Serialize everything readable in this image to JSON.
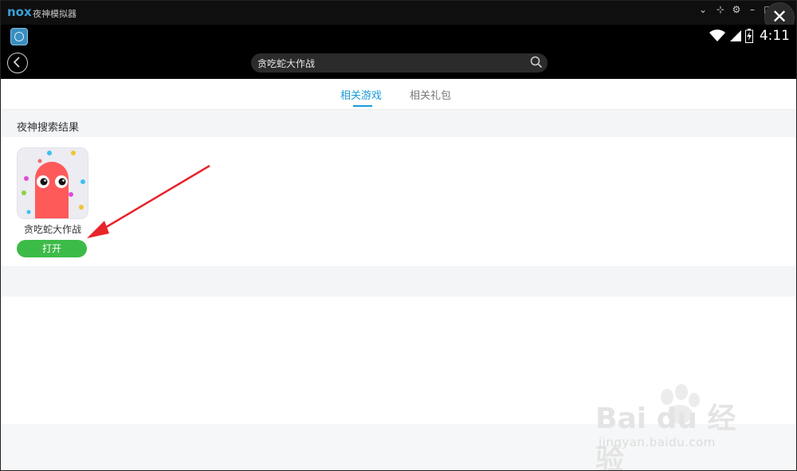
{
  "titlebar": {
    "logo": "nox",
    "title": "夜神模拟器",
    "controls": {
      "dropdown": "⌄",
      "pin": "⊹",
      "settings": "⚙",
      "minimize": "–",
      "maximize": "□",
      "close": "✕"
    }
  },
  "statusbar": {
    "time": "4:11"
  },
  "search": {
    "query": "贪吃蛇大作战"
  },
  "tabs": [
    {
      "label": "相关游戏",
      "active": true
    },
    {
      "label": "相关礼包",
      "active": false
    }
  ],
  "section": {
    "title": "夜神搜索结果"
  },
  "results": [
    {
      "name": "贪吃蛇大作战",
      "button_label": "打开"
    }
  ],
  "watermark": {
    "logo": "Bai du 经验",
    "url": "jingyan.baidu.com"
  },
  "colors": {
    "accent": "#1a9cd6",
    "button_green": "#3dbb48",
    "snake_red": "#ff5a5a",
    "annotation_red": "#e8242b"
  }
}
